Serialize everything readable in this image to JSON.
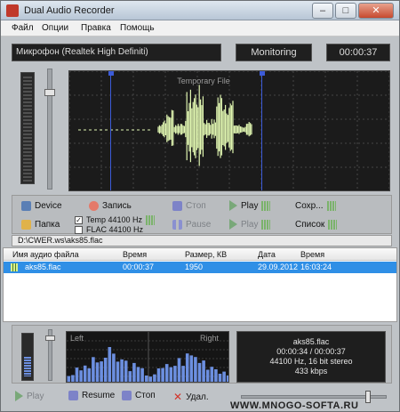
{
  "window": {
    "title": "Dual Audio Recorder",
    "controls": {
      "minimize": "–",
      "maximize": "□",
      "close": "✕"
    }
  },
  "menu": {
    "items": [
      "Файл",
      "Опции",
      "Правка",
      "Помощь"
    ]
  },
  "input": {
    "device": "Микрофон (Realtek High Definiti)",
    "mode": "Monitoring",
    "elapsed": "00:00:37"
  },
  "waveform": {
    "title": "Temporary File"
  },
  "controls": {
    "device": "Device",
    "folder": "Папка",
    "record": "Запись",
    "stop": "Стоп",
    "pause": "Pause",
    "play": "Play",
    "play_file": "Play",
    "save": "Сохр...",
    "list": "Список",
    "temp_format": "Temp 44100 Hz",
    "flac_format": "FLAC 44100 Hz",
    "temp_checked": "✓"
  },
  "path": {
    "value": "D:\\CWER.ws\\aks85.flac"
  },
  "files": {
    "columns": [
      "Имя аудио файла",
      "Время",
      "Размер, КВ",
      "Дата",
      "Время"
    ],
    "rows": [
      {
        "name": "aks85.flac",
        "duration": "00:00:37",
        "size": "1950",
        "date": "29.09.2012",
        "time": "16:03:24"
      }
    ]
  },
  "spectrum": {
    "left_label": "Left",
    "right_label": "Right"
  },
  "now_playing": {
    "file": "aks85.flac",
    "position": "00:00:34 / 00:00:37",
    "format": "44100 Hz, 16 bit stereo",
    "bitrate": "433 kbps"
  },
  "player": {
    "play": "Play",
    "resume": "Resume",
    "stop": "Стоп",
    "delete": "Удал.",
    "volume": 0.88
  },
  "watermark": "WWW.MNOGO-SOFTA.RU",
  "colors": {
    "selection": "#2f8fe6",
    "wave": "#dff5b0",
    "spectrum_bars": "#6c8fe0",
    "marker": "#3c5bd8"
  }
}
